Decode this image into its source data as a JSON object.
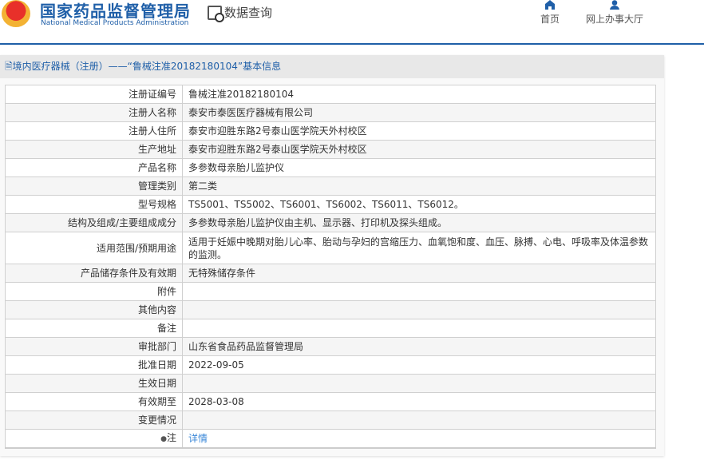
{
  "header": {
    "logo_cn": "国家药品监督管理局",
    "logo_en": "National Medical Products Administration",
    "query_label": "数据查询",
    "nav": [
      {
        "label": "首页",
        "icon": "home-icon"
      },
      {
        "label": "网上办事大厅",
        "icon": "user-icon"
      }
    ]
  },
  "panel": {
    "title": "境内医疗器械（注册）——“鲁械注准20182180104”基本信息"
  },
  "rows": [
    {
      "label": "注册证编号",
      "value": "鲁械注准20182180104"
    },
    {
      "label": "注册人名称",
      "value": "泰安市泰医医疗器械有限公司"
    },
    {
      "label": "注册人住所",
      "value": "泰安市迎胜东路2号泰山医学院天外村校区"
    },
    {
      "label": "生产地址",
      "value": "泰安市迎胜东路2号泰山医学院天外村校区"
    },
    {
      "label": "产品名称",
      "value": "多参数母亲胎儿监护仪"
    },
    {
      "label": "管理类别",
      "value": "第二类"
    },
    {
      "label": "型号规格",
      "value": "TS5001、TS5002、TS6001、TS6002、TS6011、TS6012。"
    },
    {
      "label": "结构及组成/主要组成成分",
      "value": "多参数母亲胎儿监护仪由主机、显示器、打印机及探头组成。"
    },
    {
      "label": "适用范围/预期用途",
      "value": "适用于妊娠中晚期对胎儿心率、胎动与孕妇的宫缩压力、血氧饱和度、血压、脉搏、心电、呼吸率及体温参数的监测。"
    },
    {
      "label": "产品储存条件及有效期",
      "value": "无特殊储存条件"
    },
    {
      "label": "附件",
      "value": ""
    },
    {
      "label": "其他内容",
      "value": ""
    },
    {
      "label": "备注",
      "value": ""
    },
    {
      "label": "审批部门",
      "value": "山东省食品药品监督管理局"
    },
    {
      "label": "批准日期",
      "value": "2022-09-05"
    },
    {
      "label": "生效日期",
      "value": ""
    },
    {
      "label": "有效期至",
      "value": "2028-03-08"
    },
    {
      "label": "变更情况",
      "value": ""
    },
    {
      "label": "注",
      "value": "详情"
    }
  ]
}
